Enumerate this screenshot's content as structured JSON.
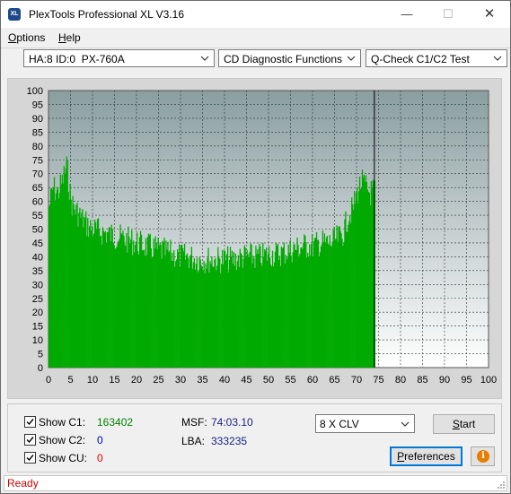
{
  "window": {
    "title": "PlexTools Professional XL V3.16",
    "icon_text": "XL",
    "min_glyph": "—",
    "max_glyph": "☐",
    "close_glyph": "✕"
  },
  "menu": {
    "options_first": "O",
    "options_rest": "ptions",
    "help_first": "H",
    "help_rest": "elp"
  },
  "toolbar": {
    "drive": "HA:8 ID:0  PX-760A",
    "function": "CD Diagnostic Functions",
    "test": "Q-Check C1/C2 Test"
  },
  "chart_data": {
    "type": "bar",
    "x_range": [
      0,
      100
    ],
    "y_range": [
      0,
      100
    ],
    "x_ticks": [
      0,
      5,
      10,
      15,
      20,
      25,
      30,
      35,
      40,
      45,
      50,
      55,
      60,
      65,
      70,
      75,
      80,
      85,
      90,
      95,
      100
    ],
    "y_ticks": [
      0,
      5,
      10,
      15,
      20,
      25,
      30,
      35,
      40,
      45,
      50,
      55,
      60,
      65,
      70,
      75,
      80,
      85,
      90,
      95,
      100
    ],
    "grid": true,
    "data_end_x": 74.05,
    "series": [
      {
        "color": "#00aa00",
        "x": [
          0,
          1,
          2,
          3,
          4,
          5,
          6,
          7,
          8,
          9,
          10,
          12,
          14,
          16,
          18,
          20,
          22,
          24,
          26,
          28,
          30,
          32,
          34,
          36,
          38,
          40,
          42,
          44,
          46,
          48,
          50,
          52,
          54,
          56,
          58,
          60,
          62,
          64,
          66,
          67,
          68,
          69,
          70,
          71,
          72,
          73,
          74
        ],
        "values": [
          63,
          70,
          68,
          72,
          78,
          65,
          62,
          60,
          58,
          56,
          55,
          54,
          53,
          52,
          51,
          50,
          49,
          48,
          47,
          46,
          45,
          45,
          44,
          44,
          44,
          44,
          44,
          45,
          45,
          45,
          46,
          46,
          47,
          48,
          49,
          49,
          50,
          50,
          52,
          54,
          60,
          62,
          68,
          72,
          70,
          68,
          69
        ]
      }
    ]
  },
  "checks": {
    "c1_label": "Show C1:",
    "c1_value": "163402",
    "c2_label": "Show C2:",
    "c2_value": "0",
    "cu_label": "Show CU:",
    "cu_value": "0"
  },
  "info": {
    "msf_label": "MSF:",
    "msf_value": "74:03.10",
    "lba_label": "LBA:",
    "lba_value": "333235"
  },
  "controls": {
    "speed": "8 X CLV",
    "start_first": "S",
    "start_rest": "tart",
    "prefs_first": "P",
    "prefs_rest": "references",
    "info_glyph": "i"
  },
  "status": {
    "text": "Ready"
  }
}
